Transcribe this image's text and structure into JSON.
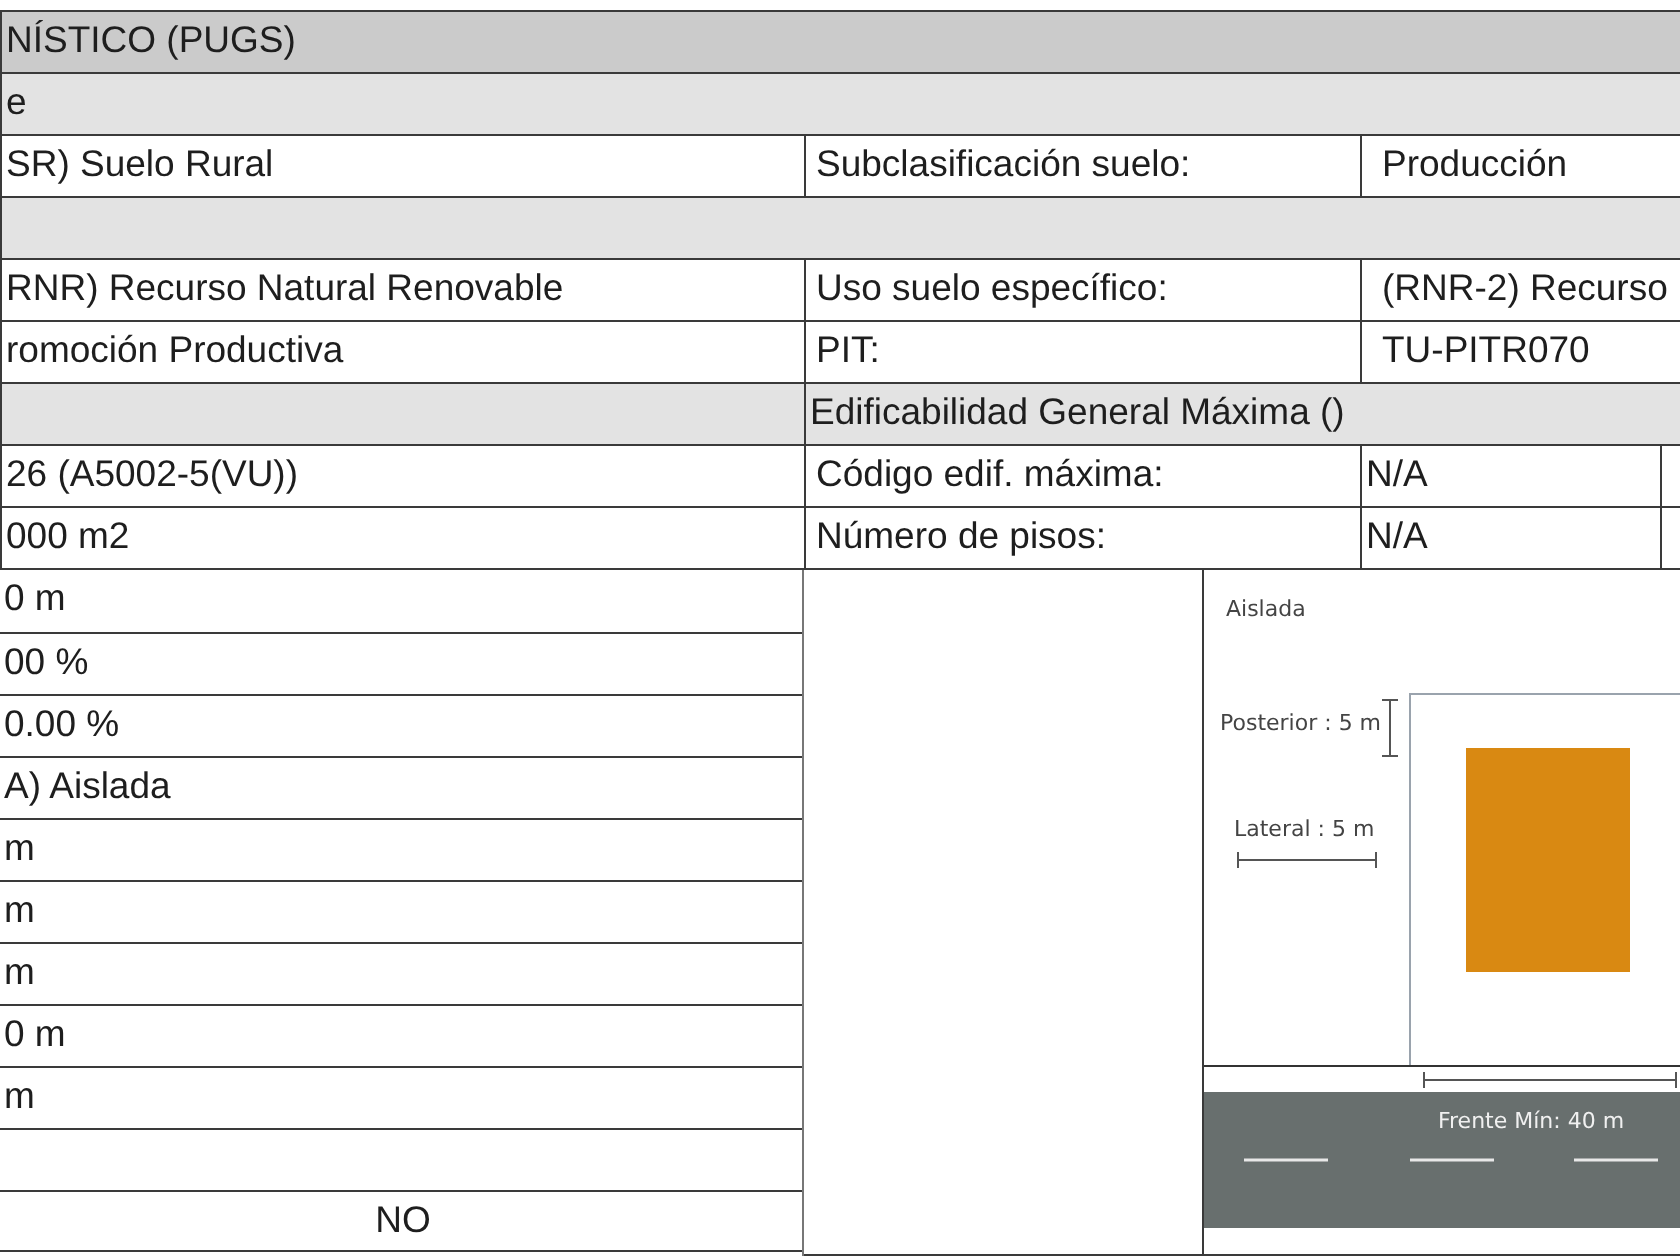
{
  "rows": [
    {
      "kind": "title",
      "text": "NÍSTICO (PUGS)"
    },
    {
      "kind": "heading",
      "text": "e"
    },
    {
      "kind": "pair",
      "value": "SR) Suelo Rural",
      "label": "Subclasificación suelo:",
      "detail": "Producción"
    },
    {
      "kind": "blank"
    },
    {
      "kind": "pair",
      "value": "RNR) Recurso Natural Renovable",
      "label": "Uso suelo específico:",
      "detail": "(RNR-2) Recurso"
    },
    {
      "kind": "pair",
      "value": "romoción Productiva",
      "label": "PIT:",
      "detail": "TU-PITR070"
    },
    {
      "kind": "split_heading",
      "text": "Edificabilidad General Máxima ()"
    },
    {
      "kind": "pair_split",
      "value": "26 (A5002-5(VU))",
      "label": "Código edif. máxima:",
      "detail": "N/A"
    },
    {
      "kind": "pair_split",
      "value": "000 m2",
      "label": "Número de pisos:",
      "detail": "N/A"
    }
  ],
  "left_rows": [
    {
      "kind": "text",
      "value": "0 m"
    },
    {
      "kind": "text",
      "value": "00 %"
    },
    {
      "kind": "text",
      "value": "0.00 %"
    },
    {
      "kind": "text",
      "value": "A) Aislada"
    },
    {
      "kind": "text",
      "value": "m"
    },
    {
      "kind": "text",
      "value": "m"
    },
    {
      "kind": "text",
      "value": "m"
    },
    {
      "kind": "text",
      "value": "0 m"
    },
    {
      "kind": "text",
      "value": "m"
    },
    {
      "kind": "empty"
    },
    {
      "kind": "centered",
      "value": "NO"
    }
  ],
  "diagram": {
    "title": "Aislada",
    "posterior": "Posterior : 5 m",
    "lateral": "Lateral : 5 m",
    "frente": "Frente Mín: 40 m"
  }
}
